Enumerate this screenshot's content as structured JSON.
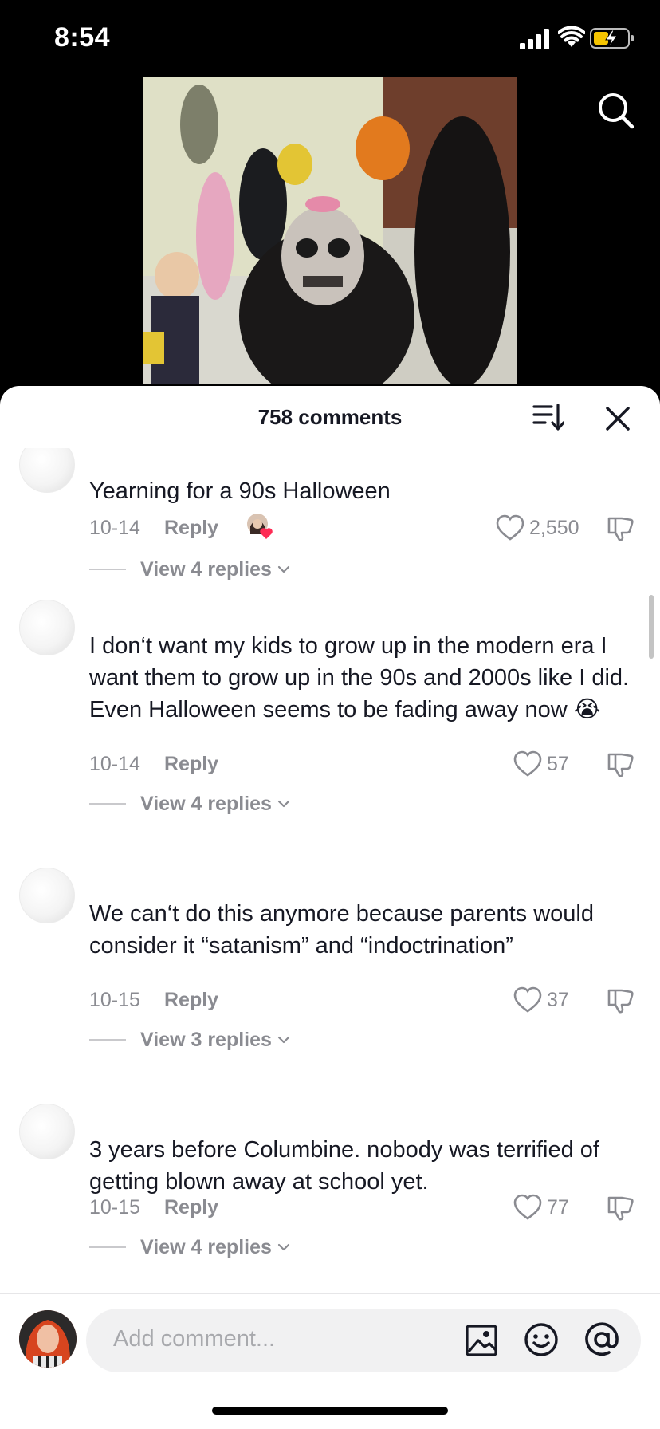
{
  "status_bar": {
    "time": "8:54"
  },
  "header": {
    "comment_count": "758 comments"
  },
  "comments": [
    {
      "text": "Yearning for a 90s Halloween",
      "date": "10-14",
      "reply_label": "Reply",
      "likes": "2,550",
      "creator_liked": true,
      "view_replies": "View 4 replies"
    },
    {
      "text": "I don‘t want my kids to grow up in the modern era I want them to grow up in the 90s and 2000s like I did. Even Halloween seems to be fading away now 😭",
      "date": "10-14",
      "reply_label": "Reply",
      "likes": "57",
      "creator_liked": false,
      "view_replies": "View 4 replies"
    },
    {
      "text": "We can‘t do this anymore because parents would consider it “satanism” and “indoctrination”",
      "date": "10-15",
      "reply_label": "Reply",
      "likes": "37",
      "creator_liked": false,
      "view_replies": "View 3 replies"
    },
    {
      "text": "3 years before Columbine. nobody was terrified of getting blown away at school yet.",
      "date": "10-15",
      "reply_label": "Reply",
      "likes": "77",
      "creator_liked": false,
      "view_replies": "View 4 replies"
    }
  ],
  "composer": {
    "placeholder": "Add comment..."
  },
  "colors": {
    "accent_heart": "#fe2c55",
    "meta_gray": "#8a8b91",
    "text_dark": "#161823"
  },
  "icons": [
    "signal-icon",
    "wifi-icon",
    "battery-charging-icon",
    "search-icon",
    "sort-icon",
    "close-icon",
    "heart-icon",
    "dislike-icon",
    "chevron-down-icon",
    "image-icon",
    "emoji-icon",
    "at-icon"
  ]
}
